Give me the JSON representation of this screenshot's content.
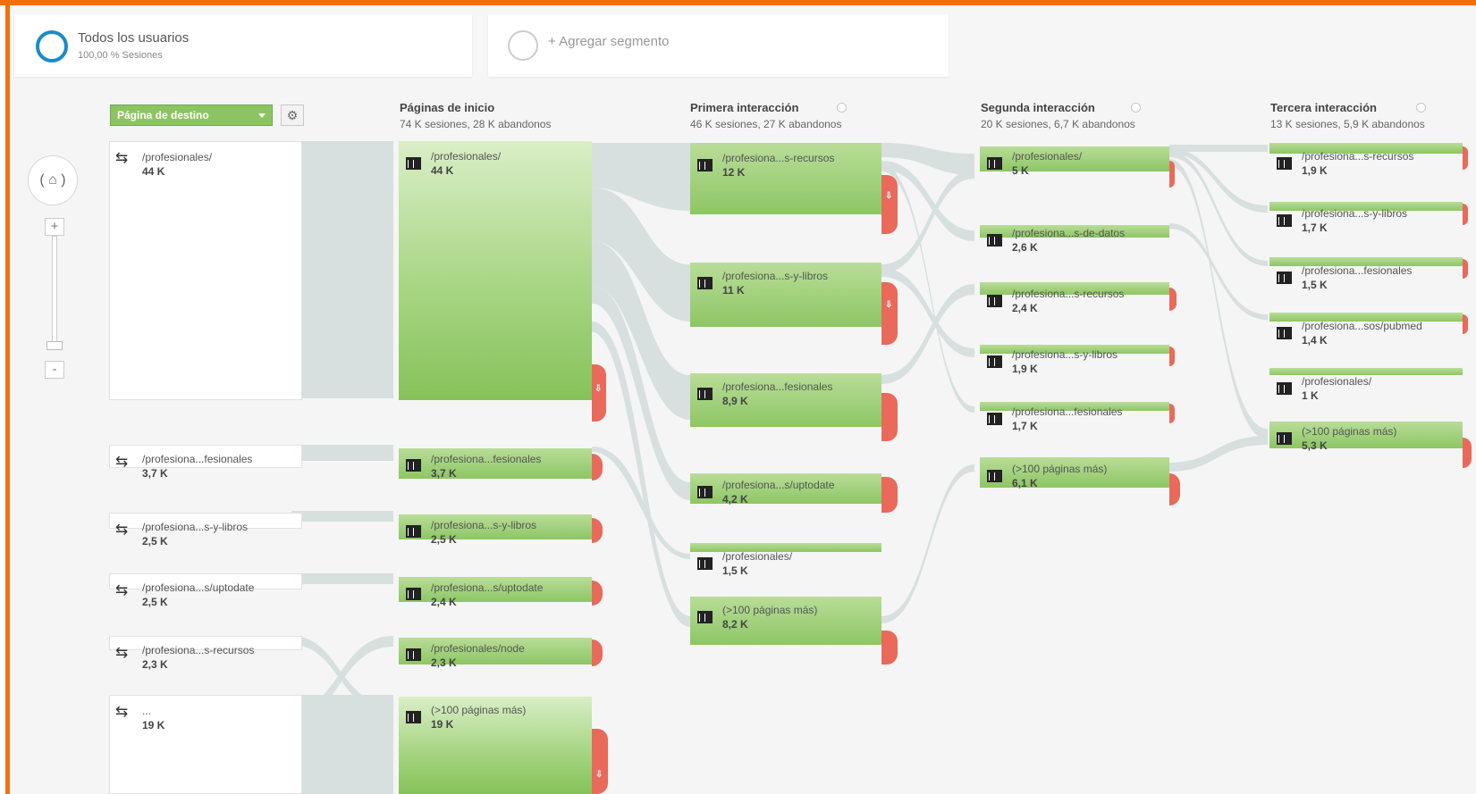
{
  "segments": [
    {
      "title": "Todos los usuarios",
      "subtitle": "100,00 % Sesiones"
    },
    {
      "title": "+ Agregar segmento",
      "subtitle": ""
    }
  ],
  "controls": {
    "dimension_dropdown": "Página de destino",
    "zoom_in": "+",
    "zoom_out": "-",
    "home": "( ⌂ )"
  },
  "columns": [
    {
      "title": "Páginas de inicio",
      "summary": "74 K sesiones, 28 K abandonos"
    },
    {
      "title": "Primera interacción",
      "summary": "46 K sesiones, 27 K abandonos"
    },
    {
      "title": "Segunda interacción",
      "summary": "20 K sesiones, 6,7 K abandonos"
    },
    {
      "title": "Tercera interacción",
      "summary": "13 K sesiones, 5,9 K abandonos"
    }
  ],
  "sources": [
    {
      "label": "/profesionales/",
      "value": "44 K"
    },
    {
      "label": "/profesiona...fesionales",
      "value": "3,7 K"
    },
    {
      "label": "/profesiona...s-y-libros",
      "value": "2,5 K"
    },
    {
      "label": "/profesiona...s/uptodate",
      "value": "2,5 K"
    },
    {
      "label": "/profesiona...s-recursos",
      "value": "2,3 K"
    },
    {
      "label": "...",
      "value": "19 K"
    }
  ],
  "start_pages": [
    {
      "label": "/profesionales/",
      "value": "44 K"
    },
    {
      "label": "/profesiona...fesionales",
      "value": "3,7 K"
    },
    {
      "label": "/profesiona...s-y-libros",
      "value": "2,5 K"
    },
    {
      "label": "/profesiona...s/uptodate",
      "value": "2,4 K"
    },
    {
      "label": "/profesionales/node",
      "value": "2,3 K"
    },
    {
      "label": "(>100 páginas más)",
      "value": "19 K"
    }
  ],
  "first_interaction": [
    {
      "label": "/profesiona...s-recursos",
      "value": "12 K"
    },
    {
      "label": "/profesiona...s-y-libros",
      "value": "11 K"
    },
    {
      "label": "/profesiona...fesionales",
      "value": "8,9 K"
    },
    {
      "label": "/profesiona...s/uptodate",
      "value": "4,2 K"
    },
    {
      "label": "/profesionales/",
      "value": "1,5 K"
    },
    {
      "label": "(>100 páginas más)",
      "value": "8,2 K"
    }
  ],
  "second_interaction": [
    {
      "label": "/profesionales/",
      "value": "5 K"
    },
    {
      "label": "/profesiona...s-de-datos",
      "value": "2,6 K"
    },
    {
      "label": "/profesiona...s-recursos",
      "value": "2,4 K"
    },
    {
      "label": "/profesiona...s-y-libros",
      "value": "1,9 K"
    },
    {
      "label": "/profesiona...fesionales",
      "value": "1,7 K"
    },
    {
      "label": "(>100 páginas más)",
      "value": "6,1 K"
    }
  ],
  "third_interaction": [
    {
      "label": "/profesiona...s-recursos",
      "value": "1,9 K"
    },
    {
      "label": "/profesiona...s-y-libros",
      "value": "1,7 K"
    },
    {
      "label": "/profesiona...fesionales",
      "value": "1,5 K"
    },
    {
      "label": "/profesiona...sos/pubmed",
      "value": "1,4 K"
    },
    {
      "label": "/profesionales/",
      "value": "1 K"
    },
    {
      "label": "(>100 páginas más)",
      "value": "5,3 K"
    }
  ],
  "colors": {
    "accent": "#f0700f",
    "node_green": "#8dc664",
    "exit_red": "#e9695a",
    "flow": "#d3dcdc"
  }
}
